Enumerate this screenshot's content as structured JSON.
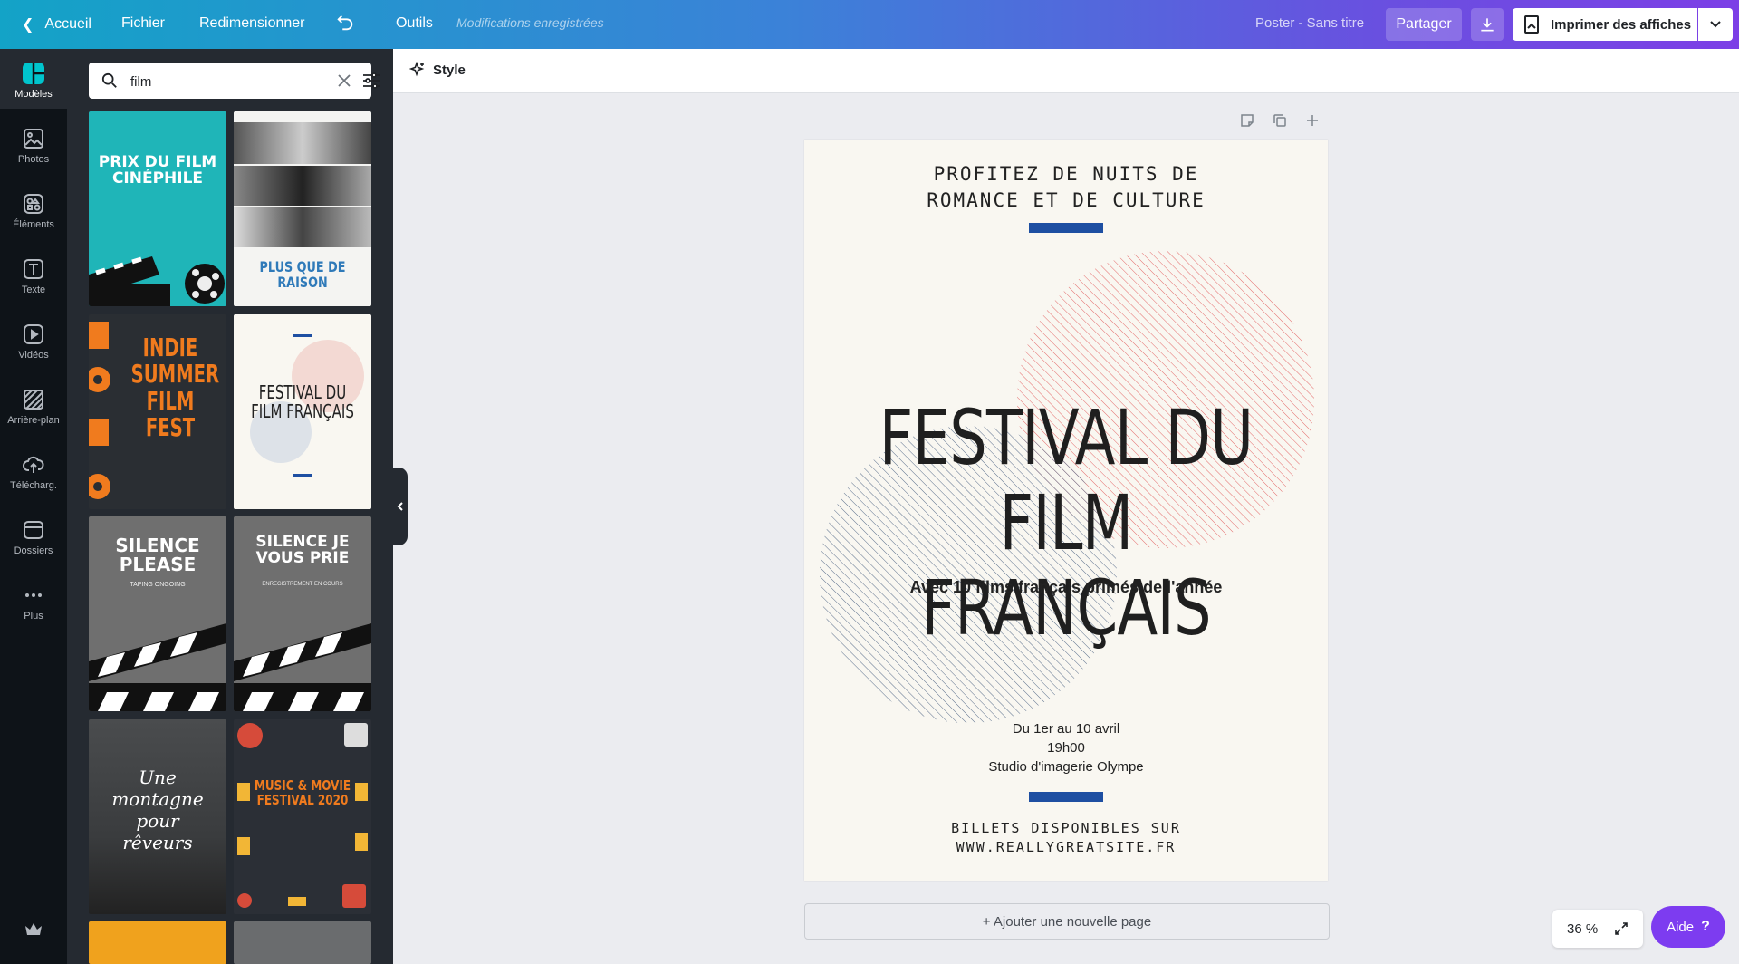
{
  "topbar": {
    "home_label": "Accueil",
    "file_label": "Fichier",
    "resize_label": "Redimensionner",
    "tools_label": "Outils",
    "saved_status": "Modifications enregistrées",
    "doc_title": "Poster - Sans titre",
    "share_label": "Partager",
    "print_label": "Imprimer des affiches"
  },
  "rail": {
    "items": [
      {
        "label": "Modèles",
        "icon": "templates-icon"
      },
      {
        "label": "Photos",
        "icon": "photos-icon"
      },
      {
        "label": "Éléments",
        "icon": "elements-icon"
      },
      {
        "label": "Texte",
        "icon": "text-icon"
      },
      {
        "label": "Vidéos",
        "icon": "videos-icon"
      },
      {
        "label": "Arrière-plan",
        "icon": "background-icon"
      },
      {
        "label": "Télécharg.",
        "icon": "uploads-icon"
      },
      {
        "label": "Dossiers",
        "icon": "folders-icon"
      },
      {
        "label": "Plus",
        "icon": "more-icon"
      }
    ]
  },
  "search": {
    "value": "film"
  },
  "thumbs": {
    "t1": {
      "title": "PRIX DU FILM CINÉPHILE"
    },
    "t2": {
      "title": "PLUS QUE DE RAISON"
    },
    "t3": {
      "title": "INDIE SUMMER FILM FEST"
    },
    "t4": {
      "title": "FESTIVAL DU FILM FRANÇAIS"
    },
    "t5": {
      "title": "SILENCE PLEASE",
      "sub": "TAPING ONGOING"
    },
    "t6": {
      "title": "SILENCE JE VOUS PRIE",
      "sub": "ENREGISTREMENT EN COURS"
    },
    "t7": {
      "title": "Une montagne pour rêveurs"
    },
    "t8": {
      "title": "MUSIC & MOVIE FESTIVAL 2020"
    }
  },
  "editor": {
    "style_label": "Style",
    "add_page_label": "+ Ajouter une nouvelle page",
    "zoom": "36 %",
    "help_label": "Aide",
    "help_icon": "?"
  },
  "poster": {
    "top_line1": "PROFITEZ DE NUITS DE",
    "top_line2": "ROMANCE ET DE CULTURE",
    "title_line1": "FESTIVAL DU",
    "title_line2": "FILM FRANÇAIS",
    "subtitle": "Avec 10 films français primés de l'année",
    "date": "Du 1er au 10 avril",
    "time": "19h00",
    "venue": "Studio d'imagerie Olympe",
    "bottom_line1": "BILLETS DISPONIBLES SUR",
    "bottom_line2": "WWW.REALLYGREATSITE.FR",
    "colors": {
      "bar": "#1e4fa2",
      "circle_red": "#e46a6a",
      "circle_blue": "#5b6f8c",
      "paper": "#f9f7f1"
    }
  }
}
